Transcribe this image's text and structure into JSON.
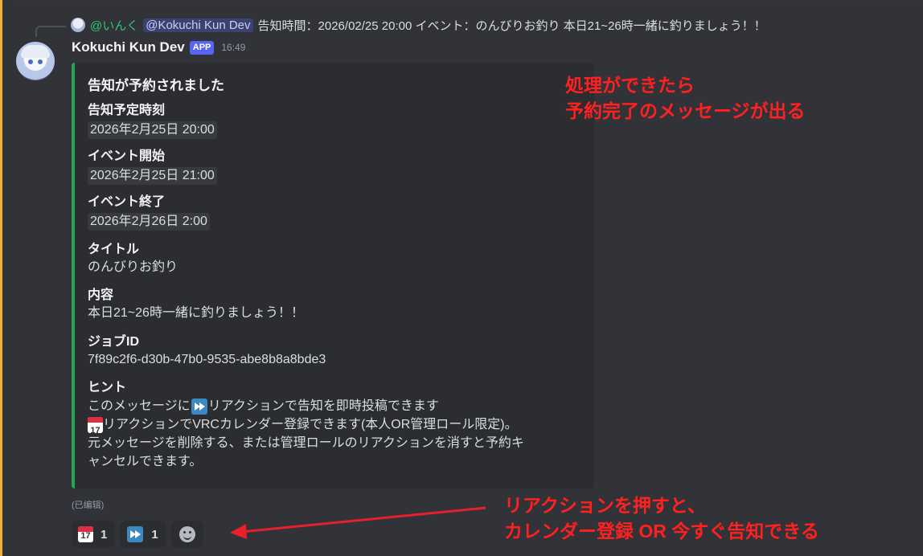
{
  "reply": {
    "author": "@いんく",
    "mention": "@Kokuchi Kun Dev",
    "text": "告知時間：2026/02/25 20:00 イベント：のんびりお釣り 本日21~26時一緒に釣りましょう！！"
  },
  "message": {
    "author": "Kokuchi Kun Dev",
    "badge": "APP",
    "time": "16:49",
    "edited": "(已编辑)"
  },
  "embed": {
    "accent": "#23a55a",
    "title": "告知が予約されました",
    "fields": [
      {
        "name": "告知予定時刻",
        "value": "2026年2月25日 20:00"
      },
      {
        "name": "イベント開始",
        "value": "2026年2月25日 21:00"
      },
      {
        "name": "イベント終了",
        "value": "2026年2月26日 2:00"
      },
      {
        "name": "タイトル",
        "value": "のんびりお釣り"
      },
      {
        "name": "内容",
        "value": "本日21~26時一緒に釣りましょう！！"
      },
      {
        "name": "ジョブID",
        "value": "7f89c2f6-d30b-47b0-9535-abe8b8a8bde3"
      }
    ],
    "hint": {
      "name": "ヒント",
      "line1_pre": "このメッセージに",
      "line1_post": "リアクションで告知を即時投稿できます",
      "line2_post": "リアクションでVRCカレンダー登録できます(本人OR管理ロール限定)。",
      "line3": "元メッセージを削除する、または管理ロールのリアクションを消すと予約キ",
      "line4": "ャンセルできます。"
    }
  },
  "reactions": [
    {
      "icon": "calendar-icon",
      "count": "1"
    },
    {
      "icon": "fast-forward-icon",
      "count": "1"
    }
  ],
  "annotations": {
    "top_line1": "処理ができたら",
    "top_line2": "予約完了のメッセージが出る",
    "bottom_line1": "リアクションを押すと、",
    "bottom_line2": "カレンダー登録 OR 今すぐ告知できる",
    "color": "#ff2020"
  }
}
